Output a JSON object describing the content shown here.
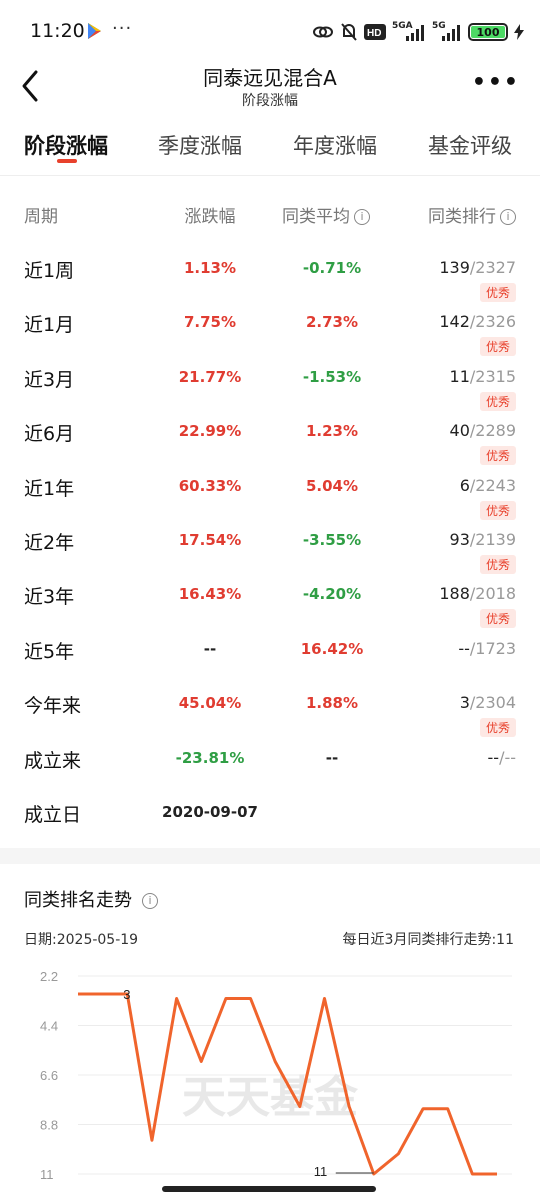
{
  "status_bar": {
    "time": "11:20",
    "dots": "···",
    "network_1": "5GA",
    "network_2": "5G",
    "battery": "100"
  },
  "header": {
    "title": "同泰远见混合A",
    "subtitle": "阶段涨幅",
    "more": "•••"
  },
  "tabs": [
    {
      "label": "阶段涨幅",
      "active": true
    },
    {
      "label": "季度涨幅",
      "active": false
    },
    {
      "label": "年度涨幅",
      "active": false
    },
    {
      "label": "基金评级",
      "active": false
    }
  ],
  "table": {
    "headers": {
      "period": "周期",
      "change": "涨跌幅",
      "avg": "同类平均",
      "rank": "同类排行"
    },
    "rows": [
      {
        "period": "近1周",
        "change": "1.13%",
        "change_color": "red",
        "avg": "-0.71%",
        "avg_color": "green",
        "rank": "139",
        "total": "/2327",
        "badge": "优秀"
      },
      {
        "period": "近1月",
        "change": "7.75%",
        "change_color": "red",
        "avg": "2.73%",
        "avg_color": "red",
        "rank": "142",
        "total": "/2326",
        "badge": "优秀"
      },
      {
        "period": "近3月",
        "change": "21.77%",
        "change_color": "red",
        "avg": "-1.53%",
        "avg_color": "green",
        "rank": "11",
        "total": "/2315",
        "badge": "优秀"
      },
      {
        "period": "近6月",
        "change": "22.99%",
        "change_color": "red",
        "avg": "1.23%",
        "avg_color": "red",
        "rank": "40",
        "total": "/2289",
        "badge": "优秀"
      },
      {
        "period": "近1年",
        "change": "60.33%",
        "change_color": "red",
        "avg": "5.04%",
        "avg_color": "red",
        "rank": "6",
        "total": "/2243",
        "badge": "优秀"
      },
      {
        "period": "近2年",
        "change": "17.54%",
        "change_color": "red",
        "avg": "-3.55%",
        "avg_color": "green",
        "rank": "93",
        "total": "/2139",
        "badge": "优秀"
      },
      {
        "period": "近3年",
        "change": "16.43%",
        "change_color": "red",
        "avg": "-4.20%",
        "avg_color": "green",
        "rank": "188",
        "total": "/2018",
        "badge": "优秀"
      },
      {
        "period": "近5年",
        "change": "--",
        "change_color": "plain",
        "avg": "16.42%",
        "avg_color": "red",
        "rank": "--",
        "total": "/1723",
        "badge": ""
      },
      {
        "period": "今年来",
        "change": "45.04%",
        "change_color": "red",
        "avg": "1.88%",
        "avg_color": "red",
        "rank": "3",
        "total": "/2304",
        "badge": "优秀"
      },
      {
        "period": "成立来",
        "change": "-23.81%",
        "change_color": "green",
        "avg": "--",
        "avg_color": "plain",
        "rank": "--",
        "total": "/--",
        "badge": ""
      },
      {
        "period": "成立日",
        "change": "2020-09-07",
        "change_color": "plain",
        "avg": "",
        "avg_color": "plain",
        "rank": "",
        "total": "",
        "badge": ""
      }
    ]
  },
  "chart_section": {
    "title": "同类排名走势",
    "date_label": "日期:2025-05-19",
    "trend_label": "每日近3月同类排行走势:11",
    "watermark": "天天基金"
  },
  "chart_data": {
    "type": "line",
    "title": "同类排名走势",
    "y_tick_labels": [
      "2.2",
      "4.4",
      "6.6",
      "8.8",
      "11"
    ],
    "ylim": [
      2.2,
      11
    ],
    "y_inverted": true,
    "annotations": [
      {
        "label": "3",
        "x": 2,
        "y": 3
      },
      {
        "label": "11",
        "x": 12,
        "y": 11
      }
    ],
    "series": [
      {
        "values": [
          3,
          3,
          3,
          9.5,
          3.2,
          6,
          3.2,
          3.2,
          6,
          8,
          3.2,
          8,
          11,
          10.1,
          8.1,
          8.1,
          11,
          11
        ],
        "color": "#f0642c"
      }
    ],
    "grid": true
  },
  "colors": {
    "up": "#e03c31",
    "down": "#2f9e44",
    "accent": "#e8412c",
    "line": "#f0642c"
  }
}
